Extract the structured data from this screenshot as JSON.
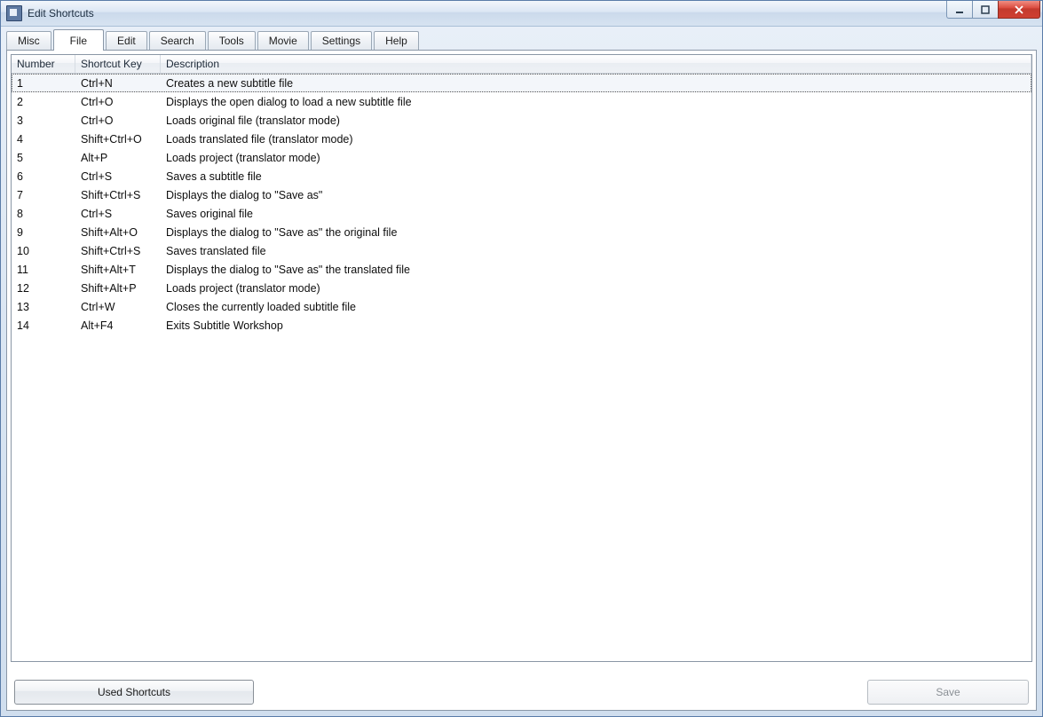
{
  "window": {
    "title": "Edit Shortcuts"
  },
  "tabs": [
    {
      "label": "Misc",
      "active": false
    },
    {
      "label": "File",
      "active": true
    },
    {
      "label": "Edit",
      "active": false
    },
    {
      "label": "Search",
      "active": false
    },
    {
      "label": "Tools",
      "active": false
    },
    {
      "label": "Movie",
      "active": false
    },
    {
      "label": "Settings",
      "active": false
    },
    {
      "label": "Help",
      "active": false
    }
  ],
  "columns": {
    "number": "Number",
    "shortcut": "Shortcut Key",
    "description": "Description"
  },
  "rows": [
    {
      "number": "1",
      "key": "Ctrl+N",
      "desc": "Creates a new subtitle file"
    },
    {
      "number": "2",
      "key": "Ctrl+O",
      "desc": "Displays the open dialog to load a new subtitle file"
    },
    {
      "number": "3",
      "key": "Ctrl+O",
      "desc": "Loads original file (translator mode)"
    },
    {
      "number": "4",
      "key": "Shift+Ctrl+O",
      "desc": "Loads translated file (translator mode)"
    },
    {
      "number": "5",
      "key": "Alt+P",
      "desc": "Loads project (translator mode)"
    },
    {
      "number": "6",
      "key": "Ctrl+S",
      "desc": "Saves a subtitle file"
    },
    {
      "number": "7",
      "key": "Shift+Ctrl+S",
      "desc": "Displays the dialog to \"Save as\""
    },
    {
      "number": "8",
      "key": "Ctrl+S",
      "desc": "Saves original file"
    },
    {
      "number": "9",
      "key": "Shift+Alt+O",
      "desc": "Displays the dialog to \"Save as\" the original file"
    },
    {
      "number": "10",
      "key": "Shift+Ctrl+S",
      "desc": "Saves translated file"
    },
    {
      "number": "11",
      "key": "Shift+Alt+T",
      "desc": "Displays the dialog to \"Save as\" the translated file"
    },
    {
      "number": "12",
      "key": "Shift+Alt+P",
      "desc": "Loads project (translator mode)"
    },
    {
      "number": "13",
      "key": "Ctrl+W",
      "desc": "Closes the currently loaded subtitle file"
    },
    {
      "number": "14",
      "key": "Alt+F4",
      "desc": "Exits Subtitle Workshop"
    }
  ],
  "footer": {
    "used_shortcuts": "Used Shortcuts",
    "save": "Save"
  }
}
